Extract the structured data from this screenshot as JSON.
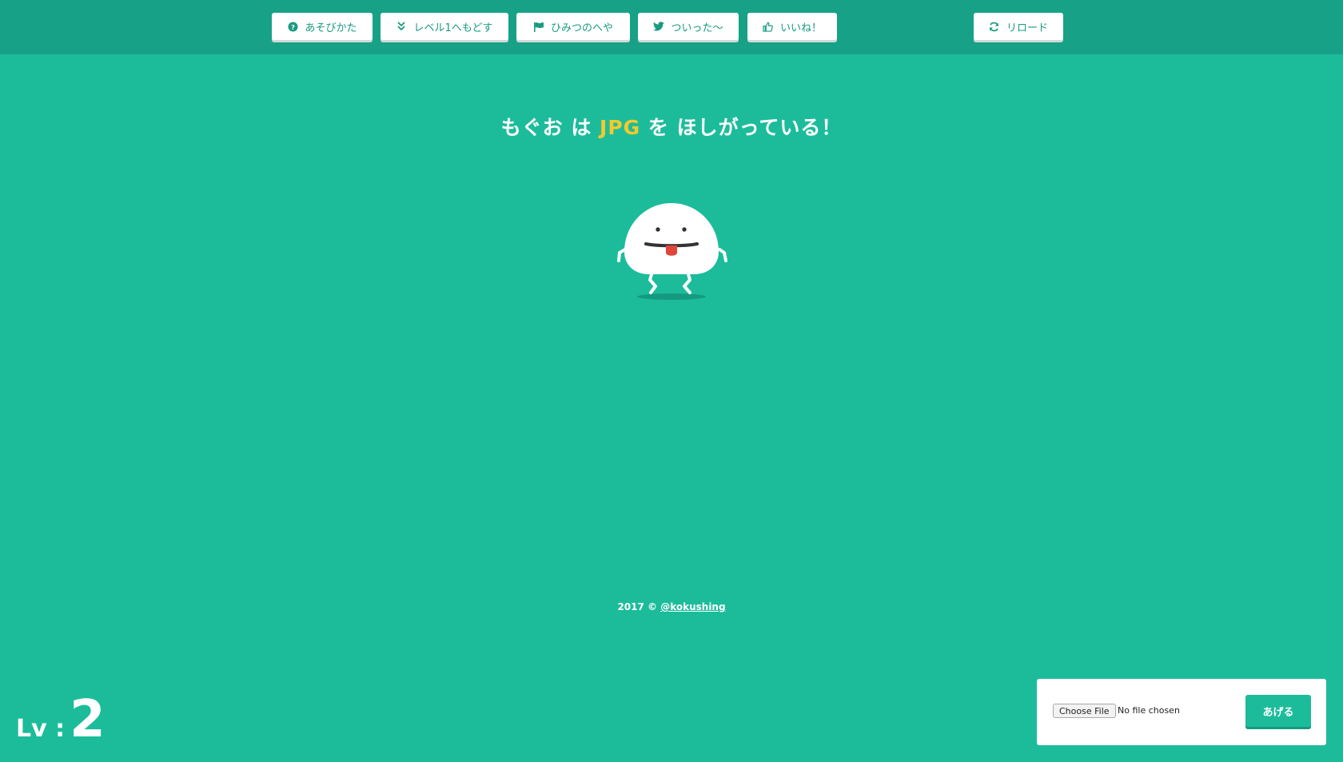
{
  "nav": {
    "howto": {
      "label": "あそびかた",
      "icon": "question-circle-icon"
    },
    "reset_level": {
      "label": "レベル1へもどす",
      "icon": "double-chevron-down-icon"
    },
    "secret_room": {
      "label": "ひみつのへや",
      "icon": "flag-icon"
    },
    "tweet": {
      "label": "ついった〜",
      "icon": "twitter-bird-icon"
    },
    "like": {
      "label": "いいね！",
      "icon": "thumbs-up-icon"
    },
    "reload": {
      "label": "リロード",
      "icon": "refresh-icon"
    }
  },
  "headline": {
    "prefix": "もぐお は ",
    "wanted": "JPG",
    "suffix": " を ほしがっている！"
  },
  "footer": {
    "text": "2017 © ",
    "link": "@kokushing"
  },
  "level": {
    "label": "Lv :",
    "value": "2"
  },
  "upload": {
    "choose_label": "Choose File",
    "status": "No file chosen",
    "submit_label": "あげる"
  },
  "colors": {
    "background": "#1cbc9b",
    "topbar": "#17a287",
    "highlight": "#f4c92e",
    "button_text": "#1a9a80",
    "tongue": "#e0453a"
  }
}
